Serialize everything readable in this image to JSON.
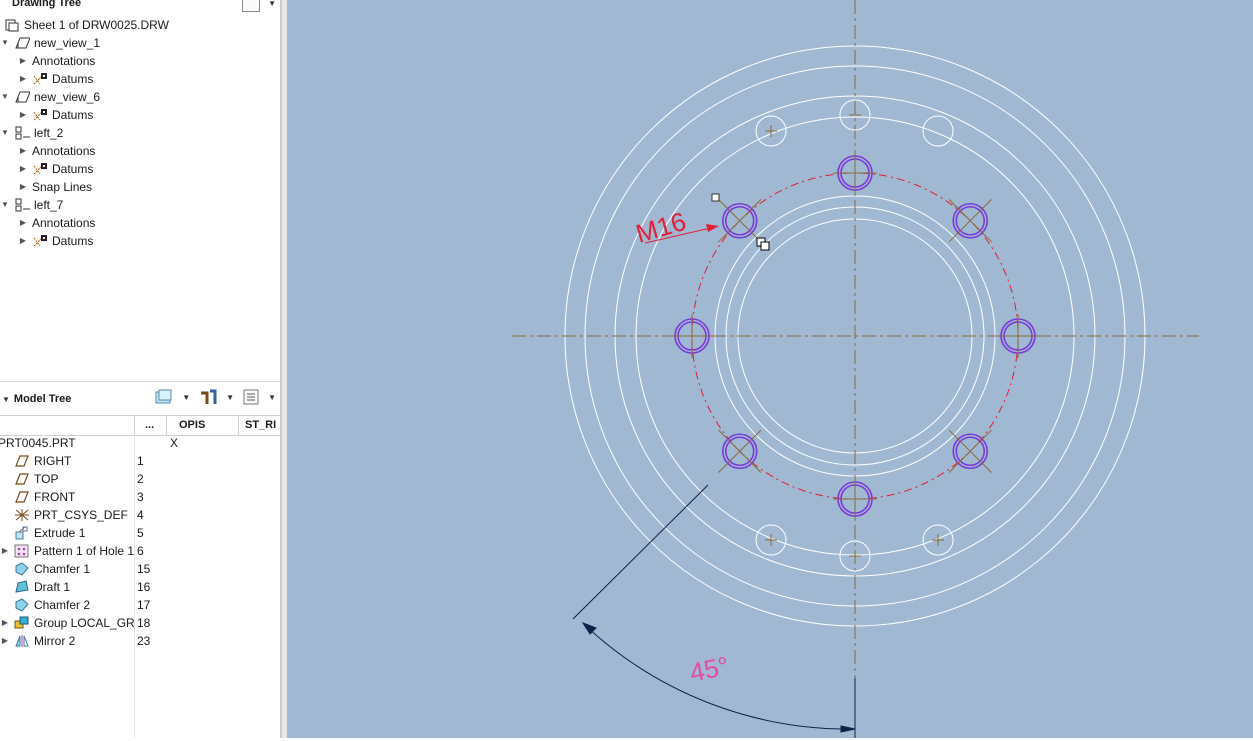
{
  "drawing_tree": {
    "title": "Drawing Tree",
    "items": [
      {
        "label": "Sheet 1 of DRW0025.DRW",
        "icon": "sheet-icon",
        "indent": 0,
        "twisty": ""
      },
      {
        "label": "new_view_1",
        "icon": "view-icon",
        "indent": 0,
        "twisty": "down"
      },
      {
        "label": "Annotations",
        "icon": "",
        "indent": 1,
        "twisty": "right"
      },
      {
        "label": "Datums",
        "icon": "datum-icon",
        "indent": 1,
        "twisty": "right"
      },
      {
        "label": "new_view_6",
        "icon": "view-icon",
        "indent": 0,
        "twisty": "down"
      },
      {
        "label": "Datums",
        "icon": "datum-icon",
        "indent": 1,
        "twisty": "right"
      },
      {
        "label": "left_2",
        "icon": "projection-view-icon",
        "indent": 0,
        "twisty": "down"
      },
      {
        "label": "Annotations",
        "icon": "",
        "indent": 1,
        "twisty": "right"
      },
      {
        "label": "Datums",
        "icon": "datum-icon",
        "indent": 1,
        "twisty": "right"
      },
      {
        "label": "Snap Lines",
        "icon": "",
        "indent": 1,
        "twisty": "right"
      },
      {
        "label": "left_7",
        "icon": "projection-view-icon",
        "indent": 0,
        "twisty": "down"
      },
      {
        "label": "Annotations",
        "icon": "",
        "indent": 1,
        "twisty": "right"
      },
      {
        "label": "Datums",
        "icon": "datum-icon",
        "indent": 1,
        "twisty": "right"
      }
    ]
  },
  "model_tree": {
    "title": "Model Tree",
    "columns": {
      "dots": "...",
      "opis": "OPIS",
      "st_ri": "ST_RI"
    },
    "root": {
      "label": "PRT0045.PRT",
      "opis": "X"
    },
    "items": [
      {
        "label": "RIGHT",
        "num": "1",
        "icon": "datum-plane-icon",
        "twisty": ""
      },
      {
        "label": "TOP",
        "num": "2",
        "icon": "datum-plane-icon",
        "twisty": ""
      },
      {
        "label": "FRONT",
        "num": "3",
        "icon": "datum-plane-icon",
        "twisty": ""
      },
      {
        "label": "PRT_CSYS_DEF",
        "num": "4",
        "icon": "csys-icon",
        "twisty": ""
      },
      {
        "label": "Extrude 1",
        "num": "5",
        "icon": "extrude-icon",
        "twisty": ""
      },
      {
        "label": "Pattern 1 of Hole 1",
        "num": "6",
        "icon": "pattern-icon",
        "twisty": "right"
      },
      {
        "label": "Chamfer 1",
        "num": "15",
        "icon": "chamfer-icon",
        "twisty": ""
      },
      {
        "label": "Draft 1",
        "num": "16",
        "icon": "draft-icon",
        "twisty": ""
      },
      {
        "label": "Chamfer 2",
        "num": "17",
        "icon": "chamfer-icon",
        "twisty": ""
      },
      {
        "label": "Group LOCAL_GR",
        "num": "18",
        "icon": "group-icon",
        "twisty": "right"
      },
      {
        "label": "Mirror 2",
        "num": "23",
        "icon": "mirror-icon",
        "twisty": "right"
      }
    ]
  },
  "drawing": {
    "thread_note": "M16",
    "angle_dim": "45°"
  }
}
